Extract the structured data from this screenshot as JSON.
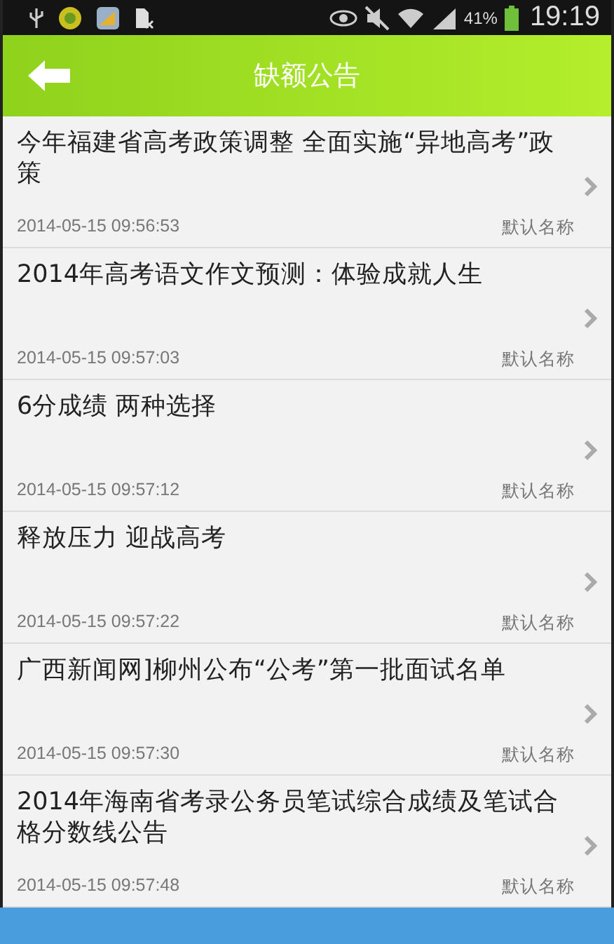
{
  "status_bar": {
    "battery": "41%",
    "time": "19:19"
  },
  "header": {
    "title": "缺额公告"
  },
  "items": [
    {
      "title": "今年福建省高考政策调整 全面实施“异地高考”政策",
      "time": "2014-05-15 09:56:53",
      "source": "默认名称"
    },
    {
      "title": "2014年高考语文作文预测：体验成就人生",
      "time": "2014-05-15 09:57:03",
      "source": "默认名称"
    },
    {
      "title": "6分成绩 两种选择",
      "time": "2014-05-15 09:57:12",
      "source": "默认名称"
    },
    {
      "title": "释放压力 迎战高考",
      "time": "2014-05-15 09:57:22",
      "source": "默认名称"
    },
    {
      "title": "广西新闻网]柳州公布“公考”第一批面试名单",
      "time": "2014-05-15 09:57:30",
      "source": "默认名称"
    },
    {
      "title": "2014年海南省考录公务员笔试综合成绩及笔试合格分数线公告",
      "time": "2014-05-15 09:57:48",
      "source": "默认名称"
    }
  ]
}
